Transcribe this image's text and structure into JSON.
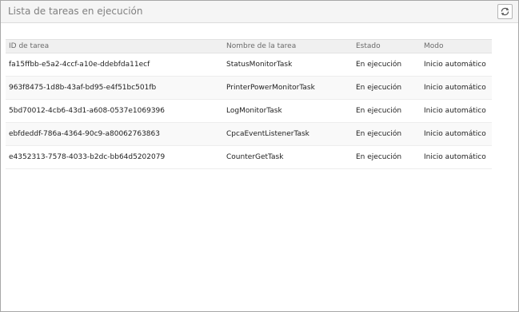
{
  "window": {
    "title": "Lista de tareas en ejecución",
    "refresh_icon": "refresh-icon"
  },
  "table": {
    "headers": {
      "id": "ID de tarea",
      "name": "Nombre de la tarea",
      "status": "Estado",
      "mode": "Modo"
    },
    "rows": [
      {
        "id": "fa15ffbb-e5a2-4ccf-a10e-ddebfda11ecf",
        "name": "StatusMonitorTask",
        "status": "En ejecución",
        "mode": "Inicio automático"
      },
      {
        "id": "963f8475-1d8b-43af-bd95-e4f51bc501fb",
        "name": "PrinterPowerMonitorTask",
        "status": "En ejecución",
        "mode": "Inicio automático"
      },
      {
        "id": "5bd70012-4cb6-43d1-a608-0537e1069396",
        "name": "LogMonitorTask",
        "status": "En ejecución",
        "mode": "Inicio automático"
      },
      {
        "id": "ebfdeddf-786a-4364-90c9-a80062763863",
        "name": "CpcaEventListenerTask",
        "status": "En ejecución",
        "mode": "Inicio automático"
      },
      {
        "id": "e4352313-7578-4033-b2dc-bb64d5202079",
        "name": "CounterGetTask",
        "status": "En ejecución",
        "mode": "Inicio automático"
      }
    ]
  }
}
